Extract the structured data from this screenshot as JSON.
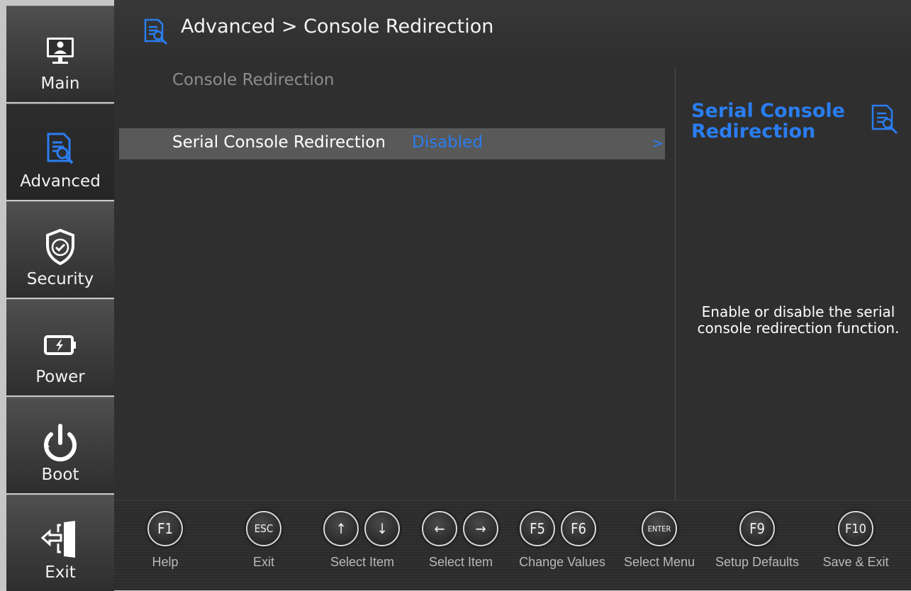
{
  "sidebar": {
    "items": [
      {
        "label": "Main",
        "icon": "monitor-user-icon",
        "active": false
      },
      {
        "label": "Advanced",
        "icon": "document-search-icon",
        "active": true
      },
      {
        "label": "Security",
        "icon": "shield-check-icon",
        "active": false
      },
      {
        "label": "Power",
        "icon": "battery-icon",
        "active": false
      },
      {
        "label": "Boot",
        "icon": "power-icon",
        "active": false
      },
      {
        "label": "Exit",
        "icon": "exit-door-icon",
        "active": false
      }
    ]
  },
  "header": {
    "breadcrumb": "Advanced > Console Redirection"
  },
  "main": {
    "section_title": "Console Redirection",
    "options": [
      {
        "label": "Serial Console Redirection",
        "value": "Disabled",
        "arrow": ">"
      }
    ]
  },
  "help": {
    "title": "Serial Console Redirection",
    "description": "Enable or disable the serial console redirection function."
  },
  "footer": {
    "keys": [
      {
        "keys": [
          "F1"
        ],
        "caption": "Help"
      },
      {
        "keys": [
          "ESC"
        ],
        "caption": "Exit"
      },
      {
        "keys": [
          "↑",
          "↓"
        ],
        "caption": "Select Item"
      },
      {
        "keys": [
          "←",
          "→"
        ],
        "caption": "Select Item"
      },
      {
        "keys": [
          "F5",
          "F6"
        ],
        "caption": "Change Values"
      },
      {
        "keys": [
          "ENTER"
        ],
        "caption": "Select Menu"
      },
      {
        "keys": [
          "F9"
        ],
        "caption": "Setup Defaults"
      },
      {
        "keys": [
          "F10"
        ],
        "caption": "Save & Exit"
      }
    ]
  },
  "colors": {
    "accent": "#2a7df0",
    "background": "#2f2f2f",
    "highlight_row": "#595959"
  }
}
